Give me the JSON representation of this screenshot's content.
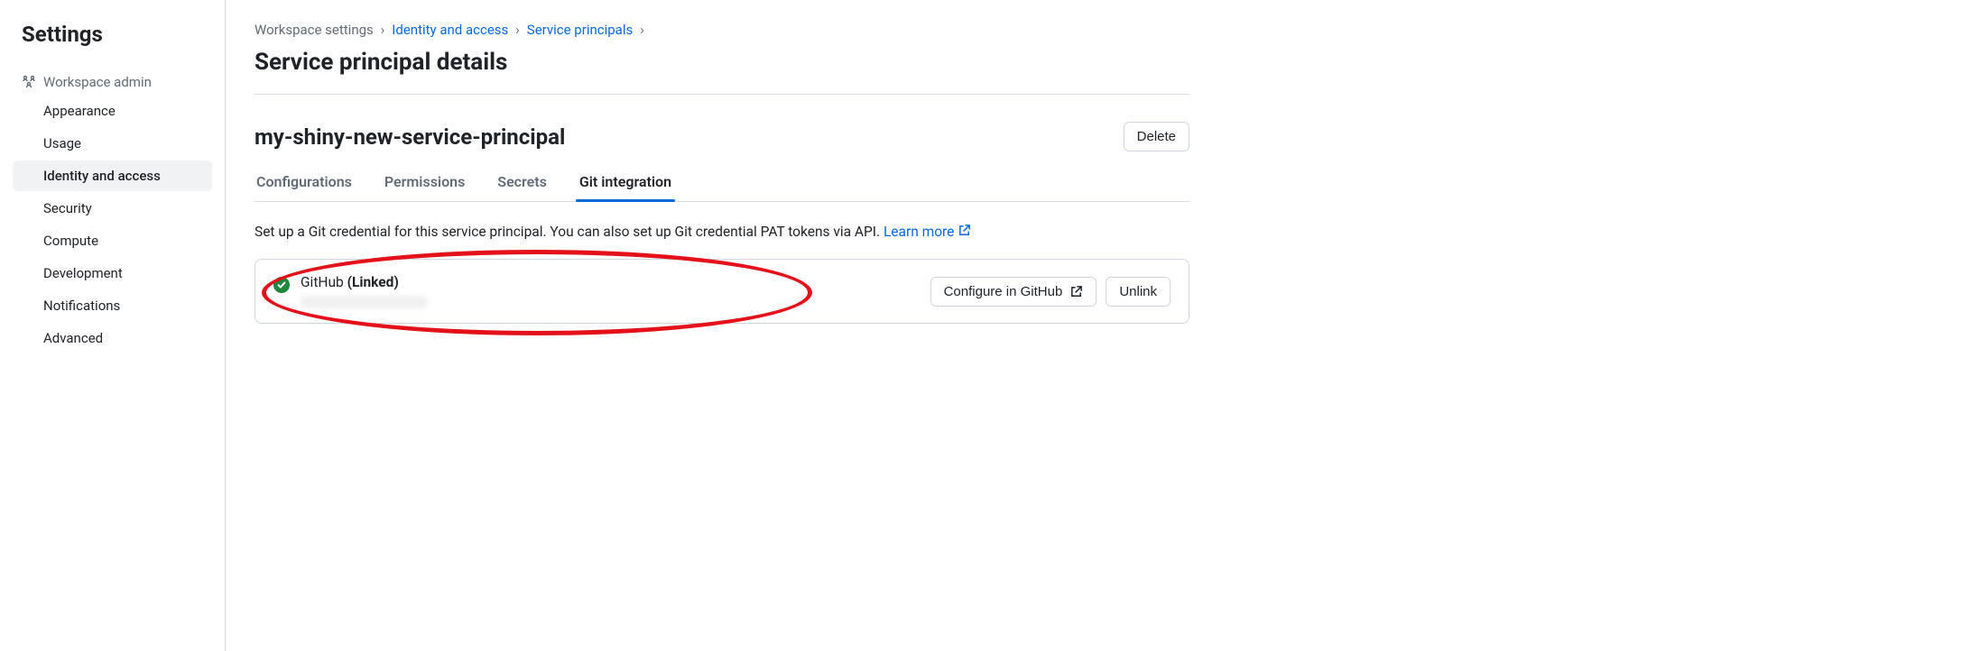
{
  "sidebar": {
    "title": "Settings",
    "section_label": "Workspace admin",
    "items": [
      {
        "label": "Appearance",
        "active": false
      },
      {
        "label": "Usage",
        "active": false
      },
      {
        "label": "Identity and access",
        "active": true
      },
      {
        "label": "Security",
        "active": false
      },
      {
        "label": "Compute",
        "active": false
      },
      {
        "label": "Development",
        "active": false
      },
      {
        "label": "Notifications",
        "active": false
      },
      {
        "label": "Advanced",
        "active": false
      }
    ]
  },
  "breadcrumb": [
    {
      "label": "Workspace settings",
      "link": false
    },
    {
      "label": "Identity and access",
      "link": true
    },
    {
      "label": "Service principals",
      "link": true
    }
  ],
  "page": {
    "title": "Service principal details",
    "principal_name": "my-shiny-new-service-principal",
    "delete_label": "Delete"
  },
  "tabs": [
    {
      "label": "Configurations",
      "active": false
    },
    {
      "label": "Permissions",
      "active": false
    },
    {
      "label": "Secrets",
      "active": false
    },
    {
      "label": "Git integration",
      "active": true
    }
  ],
  "git_section": {
    "description": "Set up a Git credential for this service principal. You can also set up Git credential PAT tokens via API. ",
    "learn_more": "Learn more",
    "provider": "GitHub",
    "status": "(Linked)",
    "configure_label": "Configure in GitHub",
    "unlink_label": "Unlink"
  }
}
